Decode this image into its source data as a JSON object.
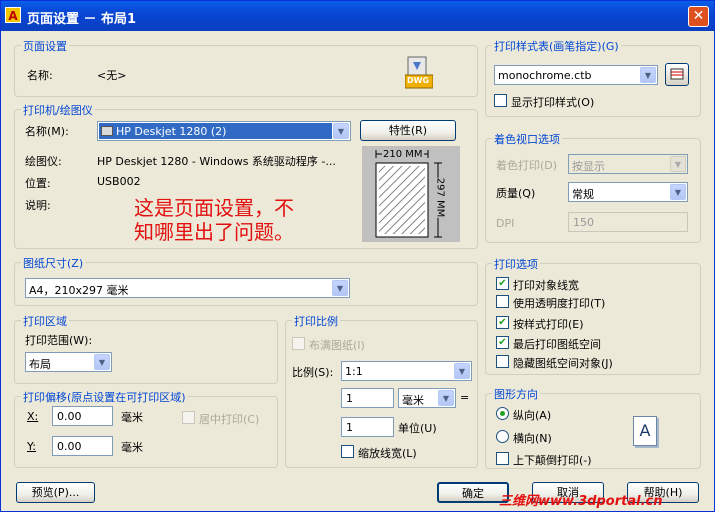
{
  "window": {
    "title": "页面设置 － 布局1",
    "close_glyph": "✕",
    "app_glyph": "A"
  },
  "page_setup": {
    "group_title": "页面设置",
    "name_label": "名称:",
    "name_value": "<无>",
    "dwg_badge": "DWG"
  },
  "printer": {
    "group_title": "打印机/绘图仪",
    "name_label": "名称(M):",
    "name_value": "HP Deskjet 1280 (2)",
    "properties_button": "特性(R)",
    "plotter_label": "绘图仪:",
    "plotter_value": "HP Deskjet 1280 - Windows 系统驱动程序 -...",
    "location_label": "位置:",
    "location_value": "USB002",
    "description_label": "说明:",
    "preview_width": "210 MM",
    "preview_height": "297 MM"
  },
  "annotation": {
    "line1": "这是页面设置，不",
    "line2": "知哪里出了问题。"
  },
  "paper_size": {
    "group_title": "图纸尺寸(Z)",
    "value": "A4，210x297 毫米"
  },
  "plot_area": {
    "group_title": "打印区域",
    "range_label": "打印范围(W):",
    "range_value": "布局"
  },
  "plot_offset": {
    "group_title": "打印偏移(原点设置在可打印区域)",
    "x_label": "X:",
    "x_value": "0.00",
    "x_unit": "毫米",
    "y_label": "Y:",
    "y_value": "0.00",
    "y_unit": "毫米",
    "center_label": "居中打印(C)"
  },
  "plot_scale": {
    "group_title": "打印比例",
    "fit_label": "布满图纸(I)",
    "scale_label": "比例(S):",
    "scale_value": "1:1",
    "value1": "1",
    "unit_value": "毫米",
    "equals": "=",
    "value2": "1",
    "unit_label": "单位(U)",
    "scale_lineweights_label": "缩放线宽(L)"
  },
  "plot_style_table": {
    "group_title": "打印样式表(画笔指定)(G)",
    "value": "monochrome.ctb",
    "display_label": "显示打印样式(O)"
  },
  "shaded_viewport": {
    "group_title": "着色视口选项",
    "shade_label": "着色打印(D)",
    "shade_value": "按显示",
    "quality_label": "质量(Q)",
    "quality_value": "常规",
    "dpi_label": "DPI",
    "dpi_value": "150"
  },
  "plot_options": {
    "group_title": "打印选项",
    "items": [
      {
        "label": "打印对象线宽",
        "checked": true
      },
      {
        "label": "使用透明度打印(T)",
        "checked": false
      },
      {
        "label": "按样式打印(E)",
        "checked": true
      },
      {
        "label": "最后打印图纸空间",
        "checked": true
      },
      {
        "label": "隐藏图纸空间对象(J)",
        "checked": false
      }
    ]
  },
  "orientation": {
    "group_title": "图形方向",
    "portrait_label": "纵向(A)",
    "landscape_label": "横向(N)",
    "upside_down_label": "上下颠倒打印(-)",
    "page_glyph": "A"
  },
  "footer": {
    "preview_button": "预览(P)...",
    "ok_button": "确定",
    "cancel_button": "取消",
    "help_button": "帮助(H)"
  },
  "watermark": "三维网www.3dportal.cn",
  "colors": {
    "title_bar": "#0a5ee8",
    "group_title": "#0046d5",
    "annotation": "#e31010",
    "dialog_bg": "#ece9d8"
  }
}
